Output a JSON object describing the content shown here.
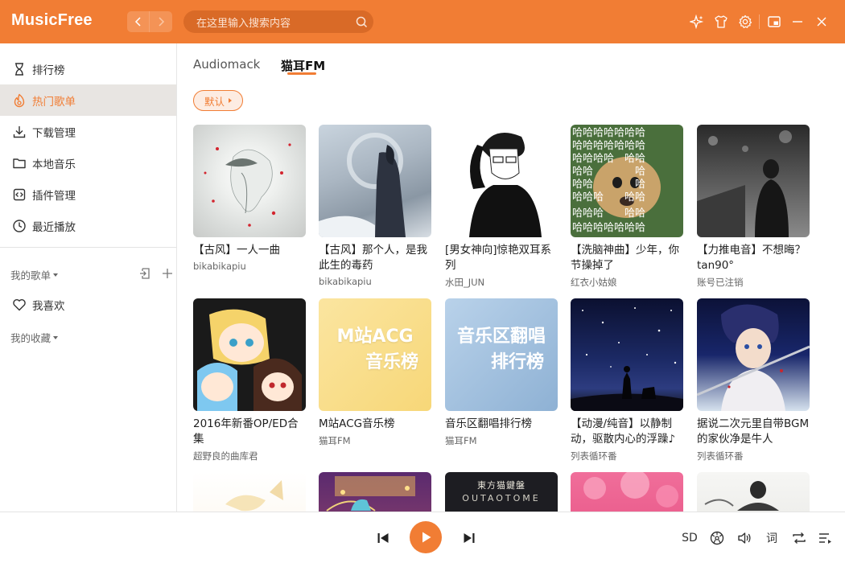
{
  "app": {
    "title": "MusicFree"
  },
  "search": {
    "placeholder": "在这里输入搜索内容"
  },
  "sidebar": {
    "items": [
      {
        "label": "排行榜",
        "icon": "trophy-icon"
      },
      {
        "label": "热门歌单",
        "icon": "hot-playlist-icon",
        "active": true
      },
      {
        "label": "下载管理",
        "icon": "download-icon"
      },
      {
        "label": "本地音乐",
        "icon": "folder-icon"
      },
      {
        "label": "插件管理",
        "icon": "plugin-icon"
      },
      {
        "label": "最近播放",
        "icon": "clock-icon"
      }
    ],
    "my_playlists_label": "我的歌单",
    "favorite_label": "我喜欢",
    "my_collections_label": "我的收藏"
  },
  "main": {
    "tabs": [
      {
        "label": "Audiomack",
        "active": false
      },
      {
        "label": "猫耳FM",
        "active": true
      }
    ],
    "sort_label": "默认",
    "cards": [
      {
        "title": "【古风】一人一曲",
        "author": "bikabikapiu"
      },
      {
        "title": "【古风】那个人，是我此生的毒药",
        "author": "bikabikapiu"
      },
      {
        "title": "[男女神向]惊艳双耳系列",
        "author": "水田_JUN"
      },
      {
        "title": "【洗脑神曲】少年，你节操掉了",
        "author": "红衣小姑娘"
      },
      {
        "title": "【力推电音】不想晦？tan90°",
        "author": "账号已注销"
      },
      {
        "title": "2016年新番OP/ED合集",
        "author": "超野良的曲库君"
      },
      {
        "title": "M站ACG音乐榜",
        "author": "猫耳FM",
        "cover_text": [
          "M站ACG",
          "音乐榜"
        ]
      },
      {
        "title": "音乐区翻唱排行榜",
        "author": "猫耳FM",
        "cover_text": [
          "音乐区翻唱",
          "排行榜"
        ]
      },
      {
        "title": "【动漫/纯音】以静制动，驱散内心的浮躁♪",
        "author": "列表循环番"
      },
      {
        "title": "据说二次元里自带BGM的家伙净是牛人",
        "author": "列表循环番"
      },
      {
        "title": "",
        "author": ""
      },
      {
        "title": "",
        "author": ""
      },
      {
        "title": "",
        "author": "",
        "cover_text": [
          "東方猫鍵盤",
          "OUTAOTOME"
        ]
      },
      {
        "title": "",
        "author": ""
      },
      {
        "title": "",
        "author": ""
      }
    ]
  },
  "player": {
    "quality_label": "SD",
    "lyrics_label": "词"
  },
  "colors": {
    "accent": "#f17d34",
    "header_bg": "#f17d34"
  }
}
